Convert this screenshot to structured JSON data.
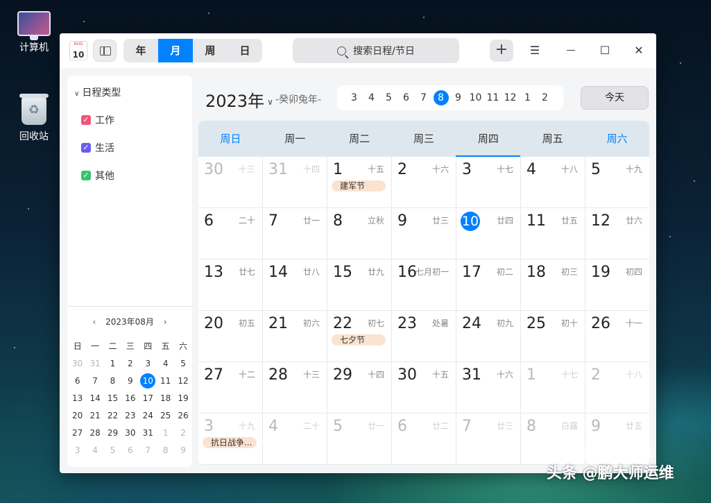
{
  "desktop": {
    "computer_label": "计算机",
    "trash_label": "回收站"
  },
  "titlebar": {
    "app_icon_month": "AUG",
    "app_icon_day": "10",
    "views": [
      "年",
      "月",
      "周",
      "日"
    ],
    "active_view": "月",
    "search_placeholder": "搜索日程/节日",
    "add_symbol": "+",
    "menu_symbol": "☰",
    "minimize_symbol": "—",
    "maximize_symbol": "☐",
    "close_symbol": "✕"
  },
  "sidebar": {
    "category_header": "日程类型",
    "categories": [
      {
        "label": "工作",
        "color": "#f2547a"
      },
      {
        "label": "生活",
        "color": "#6a5cf0"
      },
      {
        "label": "其他",
        "color": "#35c46a"
      }
    ],
    "mini": {
      "prev": "‹",
      "title": "2023年08月",
      "next": "›",
      "weekdays": [
        "日",
        "一",
        "二",
        "三",
        "四",
        "五",
        "六"
      ],
      "weeks": [
        [
          "30",
          "31",
          "1",
          "2",
          "3",
          "4",
          "5"
        ],
        [
          "6",
          "7",
          "8",
          "9",
          "10",
          "11",
          "12"
        ],
        [
          "13",
          "14",
          "15",
          "16",
          "17",
          "18",
          "19"
        ],
        [
          "20",
          "21",
          "22",
          "23",
          "24",
          "25",
          "26"
        ],
        [
          "27",
          "28",
          "29",
          "30",
          "31",
          "1",
          "2"
        ],
        [
          "3",
          "4",
          "5",
          "6",
          "7",
          "8",
          "9"
        ]
      ],
      "today": "10"
    }
  },
  "main": {
    "year": "2023年",
    "lunar_year": "-癸卯兔年-",
    "months": [
      "3",
      "4",
      "5",
      "6",
      "7",
      "8",
      "9",
      "10",
      "11",
      "12",
      "1",
      "2"
    ],
    "active_month_index": 5,
    "today_button": "今天",
    "weekdays": [
      "周日",
      "周一",
      "周二",
      "周三",
      "周四",
      "周五",
      "周六"
    ],
    "current_weekday_index": 4,
    "weeks": [
      [
        {
          "d": "30",
          "l": "十三",
          "dim": true
        },
        {
          "d": "31",
          "l": "十四",
          "dim": true
        },
        {
          "d": "1",
          "l": "十五",
          "ev": "建军节"
        },
        {
          "d": "2",
          "l": "十六"
        },
        {
          "d": "3",
          "l": "十七"
        },
        {
          "d": "4",
          "l": "十八"
        },
        {
          "d": "5",
          "l": "十九"
        }
      ],
      [
        {
          "d": "6",
          "l": "二十"
        },
        {
          "d": "7",
          "l": "廿一"
        },
        {
          "d": "8",
          "l": "立秋"
        },
        {
          "d": "9",
          "l": "廿三"
        },
        {
          "d": "10",
          "l": "廿四",
          "today": true
        },
        {
          "d": "11",
          "l": "廿五"
        },
        {
          "d": "12",
          "l": "廿六"
        }
      ],
      [
        {
          "d": "13",
          "l": "廿七"
        },
        {
          "d": "14",
          "l": "廿八"
        },
        {
          "d": "15",
          "l": "廿九"
        },
        {
          "d": "16",
          "l": "七月初一"
        },
        {
          "d": "17",
          "l": "初二"
        },
        {
          "d": "18",
          "l": "初三"
        },
        {
          "d": "19",
          "l": "初四"
        }
      ],
      [
        {
          "d": "20",
          "l": "初五"
        },
        {
          "d": "21",
          "l": "初六"
        },
        {
          "d": "22",
          "l": "初七",
          "ev": "七夕节"
        },
        {
          "d": "23",
          "l": "处暑"
        },
        {
          "d": "24",
          "l": "初九"
        },
        {
          "d": "25",
          "l": "初十"
        },
        {
          "d": "26",
          "l": "十一"
        }
      ],
      [
        {
          "d": "27",
          "l": "十二"
        },
        {
          "d": "28",
          "l": "十三"
        },
        {
          "d": "29",
          "l": "十四"
        },
        {
          "d": "30",
          "l": "十五"
        },
        {
          "d": "31",
          "l": "十六"
        },
        {
          "d": "1",
          "l": "十七",
          "dim": true
        },
        {
          "d": "2",
          "l": "十八",
          "dim": true
        }
      ],
      [
        {
          "d": "3",
          "l": "十九",
          "dim": true,
          "ev": "抗日战争..."
        },
        {
          "d": "4",
          "l": "二十",
          "dim": true
        },
        {
          "d": "5",
          "l": "廿一",
          "dim": true
        },
        {
          "d": "6",
          "l": "廿二",
          "dim": true
        },
        {
          "d": "7",
          "l": "廿三",
          "dim": true
        },
        {
          "d": "8",
          "l": "白露",
          "dim": true
        },
        {
          "d": "9",
          "l": "廿五",
          "dim": true
        }
      ]
    ]
  },
  "watermark": {
    "line1": "鹏大师运维",
    "line2": "头条 @鹏大师运维"
  },
  "colors": {
    "accent": "#0081ff",
    "event_bg": "#fbe3d1"
  }
}
